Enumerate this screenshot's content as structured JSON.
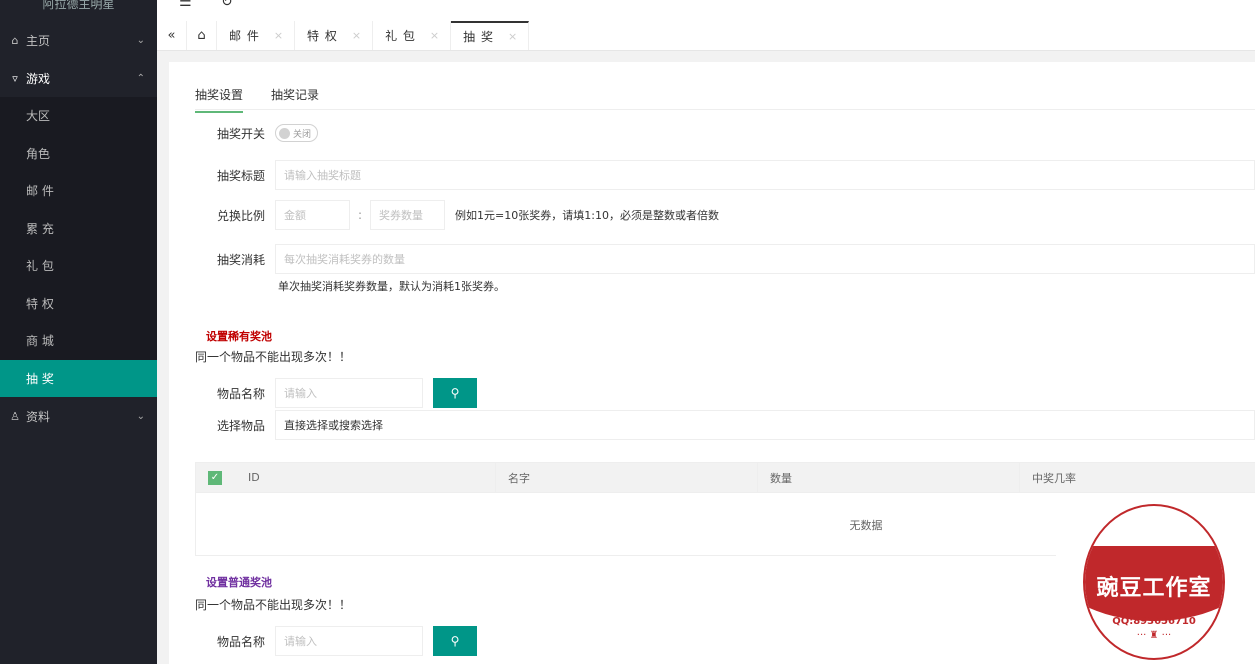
{
  "sidebar": {
    "brand": "阿拉德主明星",
    "home": "主页",
    "game": "游戏",
    "game_items": [
      "大区",
      "角色",
      "邮 件",
      "累 充",
      "礼 包",
      "特 权",
      "商 城",
      "抽 奖"
    ],
    "data": "资料"
  },
  "tabs": [
    "邮 件",
    "特 权",
    "礼 包",
    "抽 奖"
  ],
  "subtabs": [
    "抽奖设置",
    "抽奖记录"
  ],
  "form": {
    "switch_label": "抽奖开关",
    "switch_text": "关闭",
    "title_label": "抽奖标题",
    "title_placeholder": "请输入抽奖标题",
    "ratio_label": "兑换比例",
    "amount_placeholder": "金额",
    "colon": ":",
    "ticket_placeholder": "奖券数量",
    "ratio_hint": "例如1元=10张奖券，请填1:10，必须是整数或者倍数",
    "cost_label": "抽奖消耗",
    "cost_placeholder": "每次抽奖消耗奖券的数量",
    "cost_hint": "单次抽奖消耗奖券数量，默认为消耗1张奖券。"
  },
  "rare_pool": {
    "title": "设置稀有奖池",
    "title_color": "#c00000",
    "note": "同一个物品不能出现多次！！",
    "item_label": "物品名称",
    "item_placeholder": "请输入",
    "select_label": "选择物品",
    "select_value": "直接选择或搜索选择",
    "table_headers": [
      "ID",
      "名字",
      "数量",
      "中奖几率"
    ],
    "empty_text": "无数据"
  },
  "normal_pool": {
    "title": "设置普通奖池",
    "title_color": "#7030a0",
    "note": "同一个物品不能出现多次！！",
    "item_label": "物品名称",
    "item_placeholder": "请输入"
  },
  "stamp": {
    "name": "豌豆工作室",
    "qq": "QQ:893656710"
  },
  "colors": {
    "accent": "#009688",
    "sidebar": "#20222a"
  }
}
